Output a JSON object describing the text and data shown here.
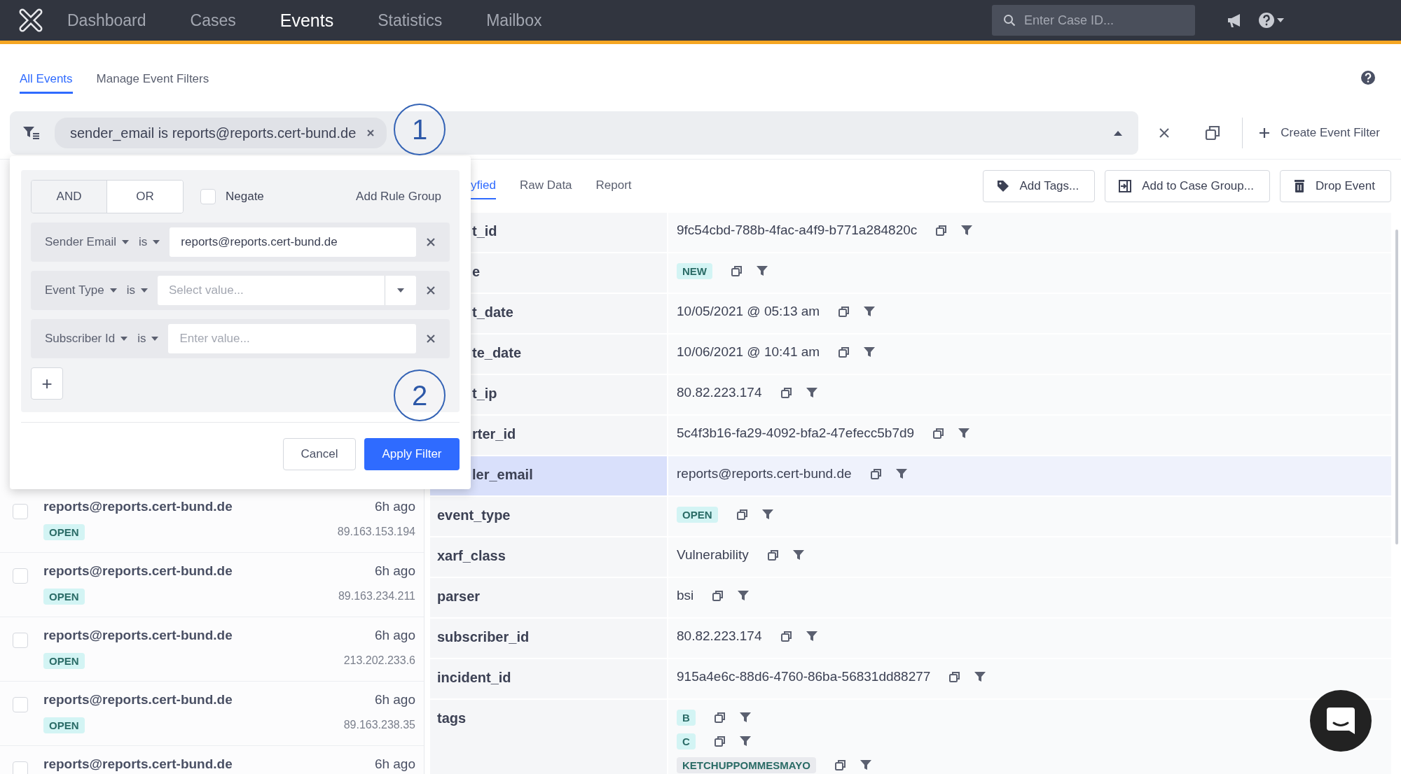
{
  "nav": {
    "items": [
      {
        "label": "Dashboard",
        "selected": false
      },
      {
        "label": "Cases",
        "selected": false
      },
      {
        "label": "Events",
        "selected": true
      },
      {
        "label": "Statistics",
        "selected": false
      },
      {
        "label": "Mailbox",
        "selected": false
      }
    ],
    "search": {
      "placeholder": "Enter Case ID..."
    }
  },
  "subtabs": [
    {
      "label": "All Events",
      "selected": true
    },
    {
      "label": "Manage Event Filters",
      "selected": false
    }
  ],
  "filter_bar": {
    "chips": [
      {
        "label": "sender_email is reports@reports.cert-bund.de"
      }
    ],
    "create_label": "Create Event Filter"
  },
  "filter_popup": {
    "combinators": [
      {
        "label": "AND",
        "selected": true
      },
      {
        "label": "OR",
        "selected": false
      }
    ],
    "negate": {
      "label": "Negate",
      "checked": false
    },
    "add_group_label": "Add Rule Group",
    "rules": [
      {
        "field": "Sender Email",
        "operator": "is",
        "kind": "input",
        "value": "reports@reports.cert-bund.de"
      },
      {
        "field": "Event Type",
        "operator": "is",
        "kind": "select",
        "placeholder": "Select value..."
      },
      {
        "field": "Subscriber Id",
        "operator": "is",
        "kind": "input",
        "placeholder": "Enter value..."
      }
    ],
    "add_rule_label": "+",
    "cancel_label": "Cancel",
    "apply_label": "Apply Filter"
  },
  "annotations": [
    "1",
    "2"
  ],
  "events": [
    {
      "sender": "reports@reports.cert-bund.de",
      "age": "6h ago",
      "status": "OPEN",
      "ip": "89.163.153.194",
      "checked": false
    },
    {
      "sender": "reports@reports.cert-bund.de",
      "age": "6h ago",
      "status": "OPEN",
      "ip": "89.163.234.211",
      "checked": false
    },
    {
      "sender": "reports@reports.cert-bund.de",
      "age": "6h ago",
      "status": "OPEN",
      "ip": "213.202.233.6",
      "checked": false
    },
    {
      "sender": "reports@reports.cert-bund.de",
      "age": "6h ago",
      "status": "OPEN",
      "ip": "89.163.238.35",
      "checked": false
    },
    {
      "sender": "reports@reports.cert-bund.de",
      "age": "6h ago",
      "checked": false
    }
  ],
  "detail": {
    "tabs": [
      {
        "label": "yfied",
        "selected": true
      },
      {
        "label": "Raw Data",
        "selected": false
      },
      {
        "label": "Report",
        "selected": false
      }
    ],
    "actions": [
      {
        "label": "Add Tags...",
        "kind": "tag"
      },
      {
        "label": "Add to Case Group...",
        "kind": "group"
      },
      {
        "label": "Drop Event",
        "kind": "drop"
      }
    ],
    "rows": [
      {
        "key": "t_id",
        "kind": "text",
        "value": "9fc54cbd-788b-4fac-a4f9-b771a284820c",
        "selected": false
      },
      {
        "key": "e",
        "kind": "badge",
        "values": [
          {
            "label": "NEW",
            "color": "#d3f4f4"
          }
        ],
        "selected": false
      },
      {
        "key": "t_date",
        "kind": "text",
        "value": "10/05/2021 @ 05:13 am",
        "selected": false
      },
      {
        "key": "te_date",
        "kind": "text",
        "value": "10/06/2021 @ 10:41 am",
        "selected": false
      },
      {
        "key": "t_ip",
        "kind": "text",
        "value": "80.82.223.174",
        "selected": false
      },
      {
        "key": "rter_id",
        "kind": "text",
        "value": "5c4f3b16-fa29-4092-bfa2-47efecc5b7d9",
        "selected": false
      },
      {
        "key": "ler_email",
        "kind": "text",
        "value": "reports@reports.cert-bund.de",
        "selected": true
      },
      {
        "key": "event_type",
        "kind": "badge",
        "values": [
          {
            "label": "OPEN",
            "color": "#d3f4f4"
          }
        ],
        "selected": false
      },
      {
        "key": "xarf_class",
        "kind": "text",
        "value": "Vulnerability",
        "selected": false
      },
      {
        "key": "parser",
        "kind": "text",
        "value": "bsi",
        "selected": false
      },
      {
        "key": "subscriber_id",
        "kind": "text",
        "value": "80.82.223.174",
        "selected": false
      },
      {
        "key": "incident_id",
        "kind": "text",
        "value": "915a4e6c-88d6-4760-86ba-56831dd88277",
        "selected": false
      },
      {
        "key": "tags",
        "kind": "badge",
        "values": [
          {
            "label": "B",
            "color": "#d3f4f4"
          },
          {
            "label": "C",
            "color": "#d3f4f4"
          },
          {
            "label": "KETCHUPPOMMESMAYO",
            "color": "#e9eaee"
          }
        ],
        "selected": false
      }
    ]
  }
}
